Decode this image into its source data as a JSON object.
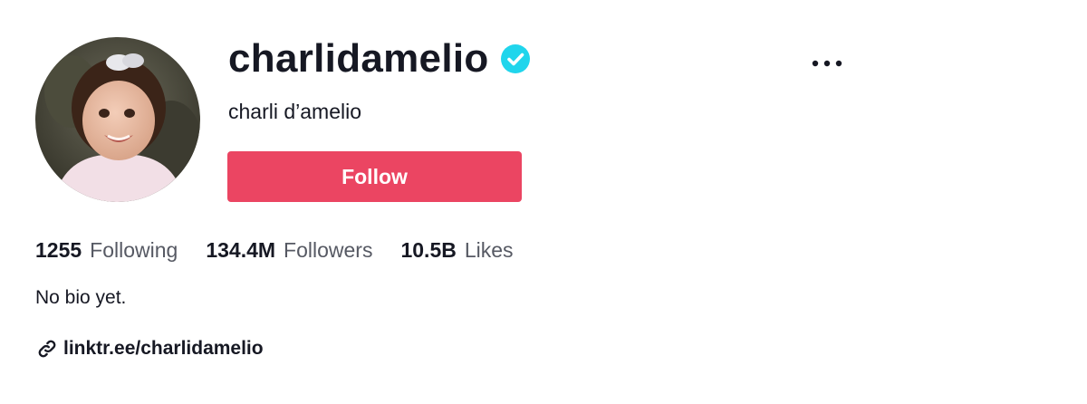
{
  "profile": {
    "username": "charlidamelio",
    "display_name": "charli d’amelio",
    "verified": true,
    "verified_icon": "verified-check-icon",
    "more_icon": "ellipsis-icon",
    "follow_label": "Follow",
    "bio": "No bio yet.",
    "link_icon": "link-icon",
    "link_text": "linktr.ee/charlidamelio"
  },
  "stats": {
    "following": {
      "value": "1255",
      "label": "Following"
    },
    "followers": {
      "value": "134.4M",
      "label": "Followers"
    },
    "likes": {
      "value": "10.5B",
      "label": "Likes"
    }
  },
  "colors": {
    "follow_button": "#eb4562",
    "verified_badge": "#20d5ec",
    "text_primary": "#161823",
    "text_secondary": "#565963"
  }
}
